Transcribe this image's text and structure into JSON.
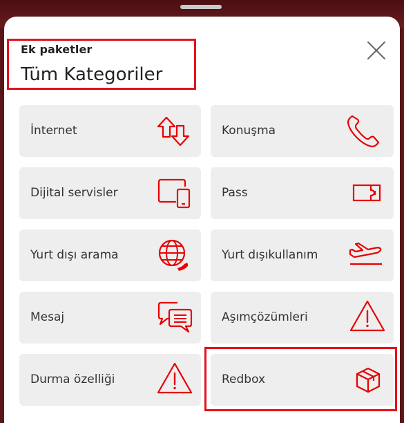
{
  "header": {
    "eyebrow": "Ek paketler",
    "title": "Tüm Kategoriler"
  },
  "close_icon": "close-icon",
  "categories": [
    {
      "label": "İnternet",
      "icon": "data-transfer-arrows-icon"
    },
    {
      "label": "Konuşma",
      "icon": "phone-icon"
    },
    {
      "label": "Dijital servisler",
      "icon": "devices-icon"
    },
    {
      "label": "Pass",
      "icon": "ticket-pass-icon"
    },
    {
      "label": "Yurt dışı arama",
      "icon": "globe-call-icon"
    },
    {
      "label_line1": "Yurt dışı",
      "label_line2": "kullanım",
      "icon": "airplane-icon"
    },
    {
      "label": "Mesaj",
      "icon": "chat-bubbles-icon"
    },
    {
      "label_line1": "Aşım",
      "label_line2": "çözümleri",
      "icon": "warning-icon"
    },
    {
      "label": "Durma özelliği",
      "icon": "warning-icon"
    },
    {
      "label": "Redbox",
      "icon": "box-icon"
    }
  ],
  "colors": {
    "accent": "#e60000",
    "highlight_border": "#e3121c",
    "card_bg": "#eeeeee",
    "backdrop": "#5a1518"
  }
}
